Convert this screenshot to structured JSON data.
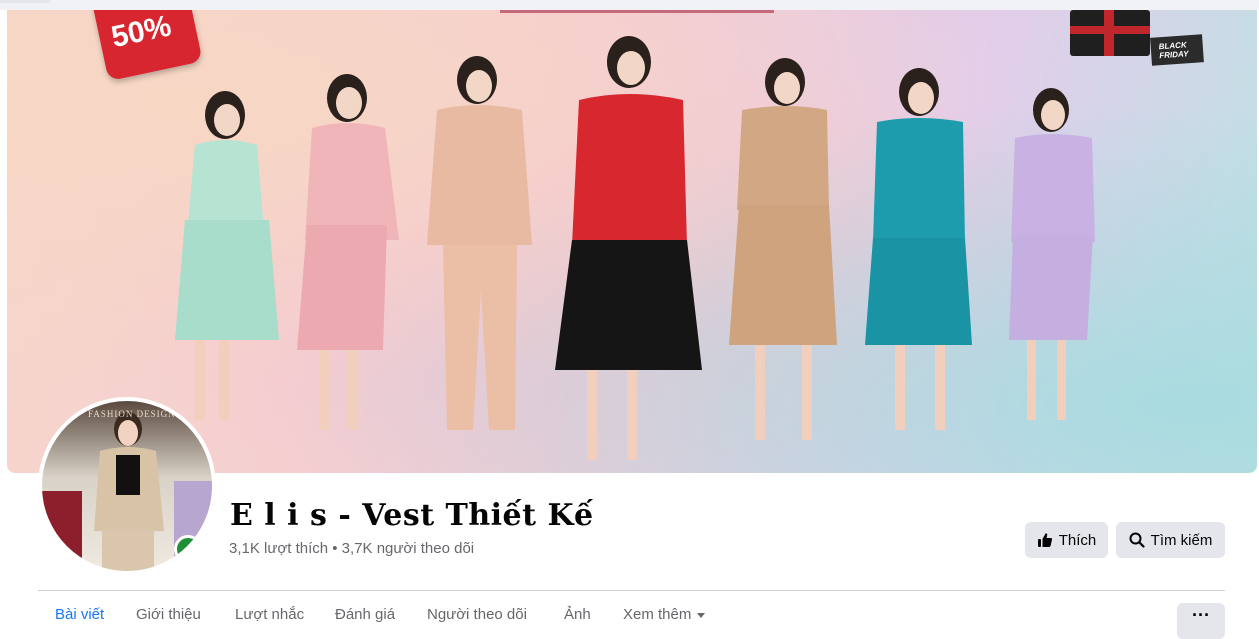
{
  "cover": {
    "sale_badge": "50%",
    "black_friday_tag": "BLACK FRIDAY"
  },
  "avatar": {
    "caption": "FASHION DESIGN",
    "status": "online"
  },
  "page": {
    "name": "E l i s - Vest Thiết Kế",
    "stats": "3,1K lượt thích • 3,7K người theo dõi"
  },
  "actions": {
    "like_label": "Thích",
    "search_label": "Tìm kiếm"
  },
  "tabs": [
    {
      "label": "Bài viết",
      "active": true
    },
    {
      "label": "Giới thiệu"
    },
    {
      "label": "Lượt nhắc"
    },
    {
      "label": "Đánh giá"
    },
    {
      "label": "Người theo dõi"
    },
    {
      "label": "Ảnh"
    },
    {
      "label": "Xem thêm"
    }
  ],
  "more_button": "···",
  "colors": {
    "accent": "#1877f2",
    "button_bg": "#e4e6eb",
    "secondary_text": "#65676b",
    "online": "#1f8f36"
  },
  "icons": {
    "like": "thumbs-up-icon",
    "search": "search-icon",
    "dropdown": "caret-down-icon",
    "more": "ellipsis-icon"
  }
}
